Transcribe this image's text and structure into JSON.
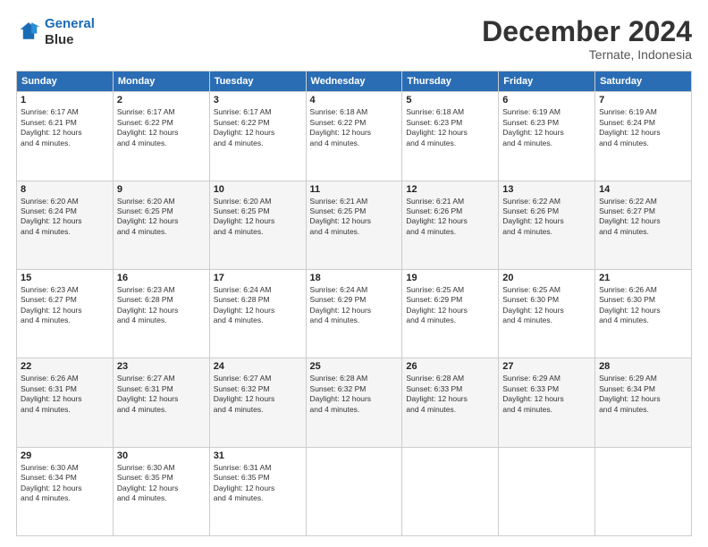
{
  "header": {
    "logo_line1": "General",
    "logo_line2": "Blue",
    "month": "December 2024",
    "location": "Ternate, Indonesia"
  },
  "days_of_week": [
    "Sunday",
    "Monday",
    "Tuesday",
    "Wednesday",
    "Thursday",
    "Friday",
    "Saturday"
  ],
  "weeks": [
    [
      {
        "day": "1",
        "sunrise": "6:17 AM",
        "sunset": "6:21 PM",
        "daylight": "12 hours and 4 minutes."
      },
      {
        "day": "2",
        "sunrise": "6:17 AM",
        "sunset": "6:22 PM",
        "daylight": "12 hours and 4 minutes."
      },
      {
        "day": "3",
        "sunrise": "6:17 AM",
        "sunset": "6:22 PM",
        "daylight": "12 hours and 4 minutes."
      },
      {
        "day": "4",
        "sunrise": "6:18 AM",
        "sunset": "6:22 PM",
        "daylight": "12 hours and 4 minutes."
      },
      {
        "day": "5",
        "sunrise": "6:18 AM",
        "sunset": "6:23 PM",
        "daylight": "12 hours and 4 minutes."
      },
      {
        "day": "6",
        "sunrise": "6:19 AM",
        "sunset": "6:23 PM",
        "daylight": "12 hours and 4 minutes."
      },
      {
        "day": "7",
        "sunrise": "6:19 AM",
        "sunset": "6:24 PM",
        "daylight": "12 hours and 4 minutes."
      }
    ],
    [
      {
        "day": "8",
        "sunrise": "6:20 AM",
        "sunset": "6:24 PM",
        "daylight": "12 hours and 4 minutes."
      },
      {
        "day": "9",
        "sunrise": "6:20 AM",
        "sunset": "6:25 PM",
        "daylight": "12 hours and 4 minutes."
      },
      {
        "day": "10",
        "sunrise": "6:20 AM",
        "sunset": "6:25 PM",
        "daylight": "12 hours and 4 minutes."
      },
      {
        "day": "11",
        "sunrise": "6:21 AM",
        "sunset": "6:25 PM",
        "daylight": "12 hours and 4 minutes."
      },
      {
        "day": "12",
        "sunrise": "6:21 AM",
        "sunset": "6:26 PM",
        "daylight": "12 hours and 4 minutes."
      },
      {
        "day": "13",
        "sunrise": "6:22 AM",
        "sunset": "6:26 PM",
        "daylight": "12 hours and 4 minutes."
      },
      {
        "day": "14",
        "sunrise": "6:22 AM",
        "sunset": "6:27 PM",
        "daylight": "12 hours and 4 minutes."
      }
    ],
    [
      {
        "day": "15",
        "sunrise": "6:23 AM",
        "sunset": "6:27 PM",
        "daylight": "12 hours and 4 minutes."
      },
      {
        "day": "16",
        "sunrise": "6:23 AM",
        "sunset": "6:28 PM",
        "daylight": "12 hours and 4 minutes."
      },
      {
        "day": "17",
        "sunrise": "6:24 AM",
        "sunset": "6:28 PM",
        "daylight": "12 hours and 4 minutes."
      },
      {
        "day": "18",
        "sunrise": "6:24 AM",
        "sunset": "6:29 PM",
        "daylight": "12 hours and 4 minutes."
      },
      {
        "day": "19",
        "sunrise": "6:25 AM",
        "sunset": "6:29 PM",
        "daylight": "12 hours and 4 minutes."
      },
      {
        "day": "20",
        "sunrise": "6:25 AM",
        "sunset": "6:30 PM",
        "daylight": "12 hours and 4 minutes."
      },
      {
        "day": "21",
        "sunrise": "6:26 AM",
        "sunset": "6:30 PM",
        "daylight": "12 hours and 4 minutes."
      }
    ],
    [
      {
        "day": "22",
        "sunrise": "6:26 AM",
        "sunset": "6:31 PM",
        "daylight": "12 hours and 4 minutes."
      },
      {
        "day": "23",
        "sunrise": "6:27 AM",
        "sunset": "6:31 PM",
        "daylight": "12 hours and 4 minutes."
      },
      {
        "day": "24",
        "sunrise": "6:27 AM",
        "sunset": "6:32 PM",
        "daylight": "12 hours and 4 minutes."
      },
      {
        "day": "25",
        "sunrise": "6:28 AM",
        "sunset": "6:32 PM",
        "daylight": "12 hours and 4 minutes."
      },
      {
        "day": "26",
        "sunrise": "6:28 AM",
        "sunset": "6:33 PM",
        "daylight": "12 hours and 4 minutes."
      },
      {
        "day": "27",
        "sunrise": "6:29 AM",
        "sunset": "6:33 PM",
        "daylight": "12 hours and 4 minutes."
      },
      {
        "day": "28",
        "sunrise": "6:29 AM",
        "sunset": "6:34 PM",
        "daylight": "12 hours and 4 minutes."
      }
    ],
    [
      {
        "day": "29",
        "sunrise": "6:30 AM",
        "sunset": "6:34 PM",
        "daylight": "12 hours and 4 minutes."
      },
      {
        "day": "30",
        "sunrise": "6:30 AM",
        "sunset": "6:35 PM",
        "daylight": "12 hours and 4 minutes."
      },
      {
        "day": "31",
        "sunrise": "6:31 AM",
        "sunset": "6:35 PM",
        "daylight": "12 hours and 4 minutes."
      },
      null,
      null,
      null,
      null
    ]
  ]
}
